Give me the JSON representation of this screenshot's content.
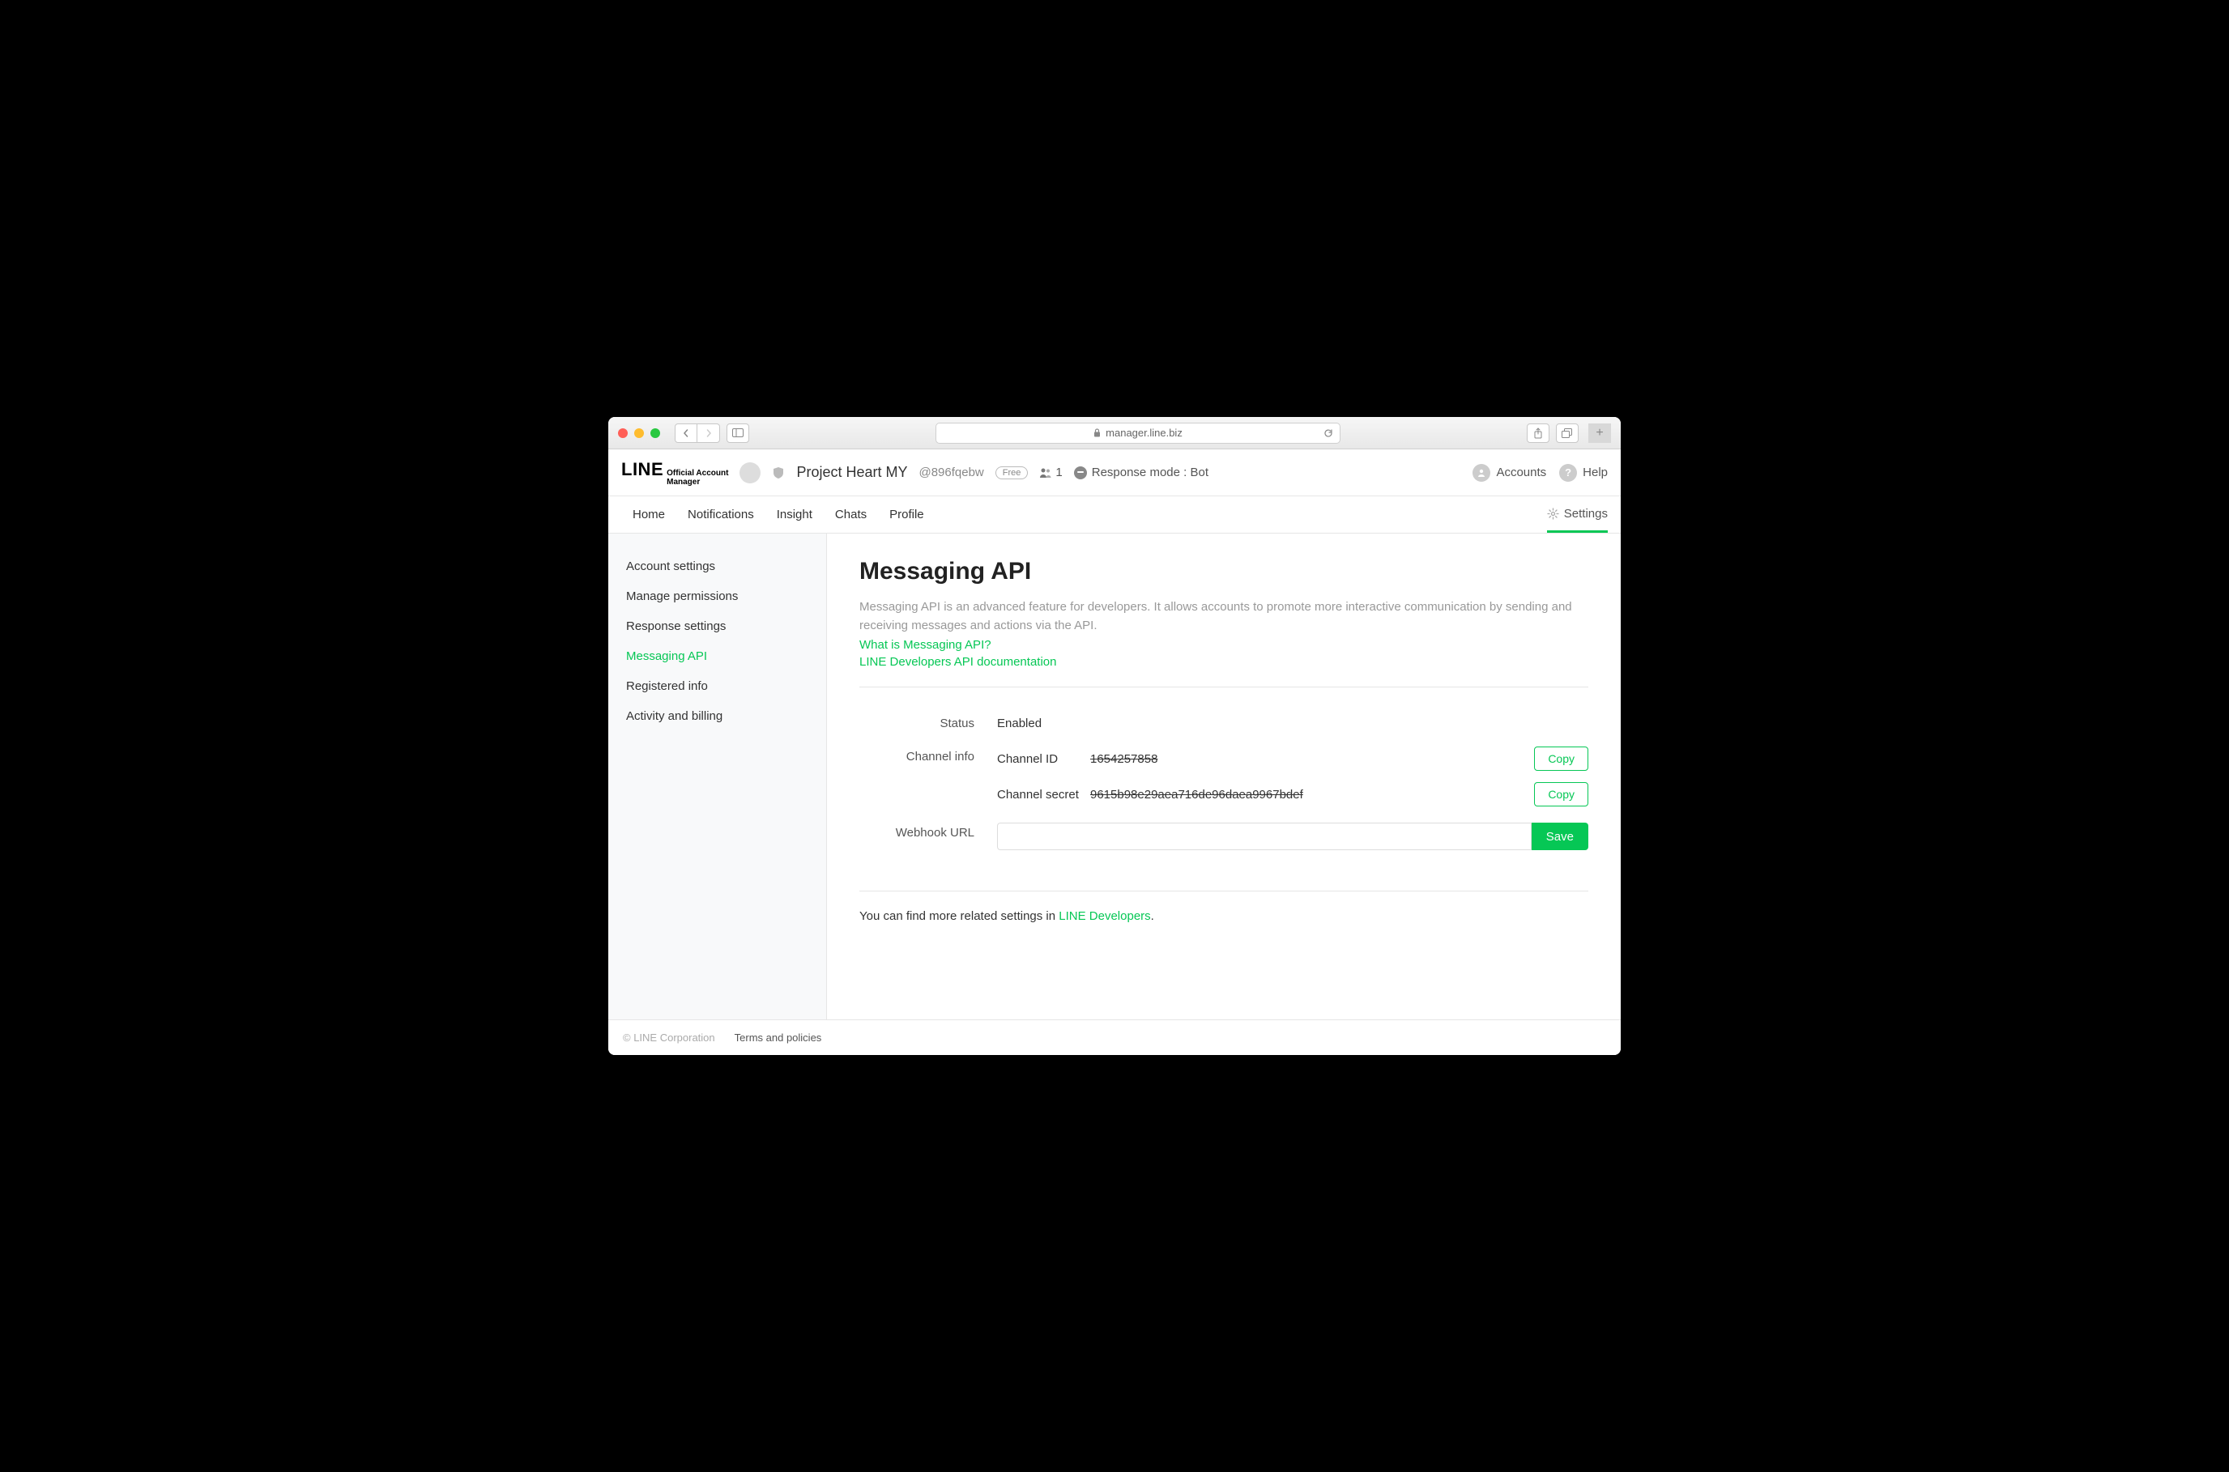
{
  "browser": {
    "url": "manager.line.biz"
  },
  "header": {
    "logo_line": "LINE",
    "logo_sub1": "Official Account",
    "logo_sub2": "Manager",
    "project_name": "Project Heart MY",
    "account_id": "@896fqebw",
    "plan_badge": "Free",
    "friend_count": "1",
    "response_mode": "Response mode : Bot",
    "accounts_label": "Accounts",
    "help_label": "Help"
  },
  "tabs": {
    "home": "Home",
    "notifications": "Notifications",
    "insight": "Insight",
    "chats": "Chats",
    "profile": "Profile",
    "settings": "Settings"
  },
  "sidebar": {
    "items": [
      "Account settings",
      "Manage permissions",
      "Response settings",
      "Messaging API",
      "Registered info",
      "Activity and billing"
    ]
  },
  "main": {
    "title": "Messaging API",
    "description": "Messaging API is an advanced feature for developers. It allows accounts to promote more interactive communication by sending and receiving messages and actions via the API.",
    "link1": "What is Messaging API?",
    "link2": "LINE Developers API documentation",
    "status_label": "Status",
    "status_value": "Enabled",
    "channel_info_label": "Channel info",
    "channel_id_label": "Channel ID",
    "channel_id_value": "1654257858",
    "channel_secret_label": "Channel secret",
    "channel_secret_value": "9615b98e29aea716de96daea9967bdef",
    "copy_label": "Copy",
    "webhook_label": "Webhook URL",
    "webhook_value": "",
    "save_label": "Save",
    "more_prefix": "You can find more related settings in ",
    "more_link": "LINE Developers",
    "more_suffix": "."
  },
  "footer": {
    "copyright": "© LINE Corporation",
    "terms": "Terms and policies"
  }
}
